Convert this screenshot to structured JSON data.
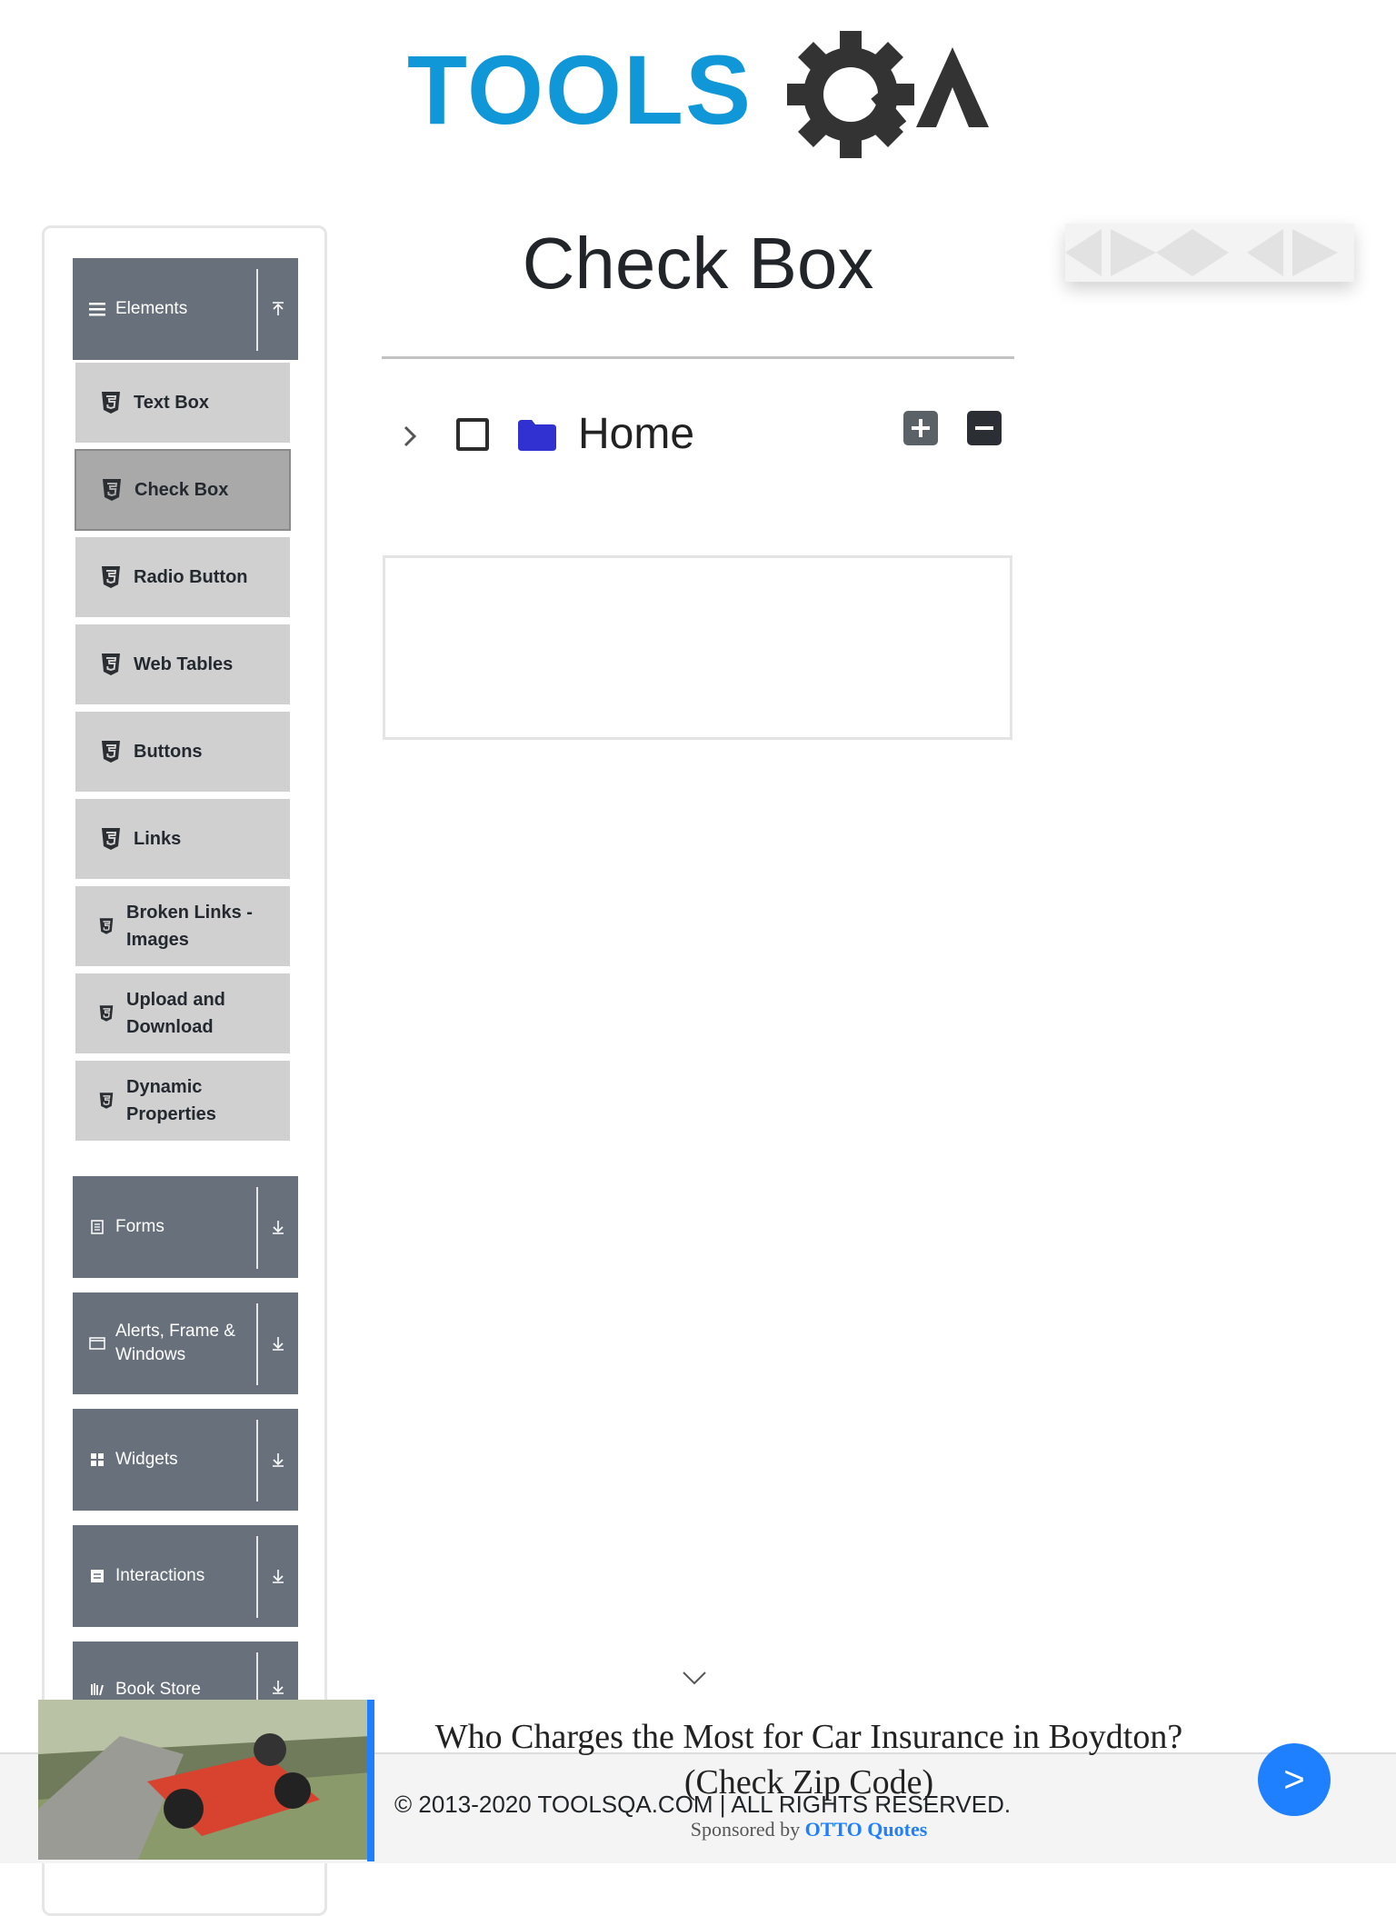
{
  "brand": {
    "logo_text": "TOOLSQA",
    "logo_tools": "TOOLS",
    "logo_q": "Q",
    "logo_a": "A",
    "logo_color": "#0f97d8",
    "logo_gear_color": "#333333"
  },
  "sidebar": {
    "groups": [
      {
        "label": "Elements",
        "icon": "menu-icon",
        "state": "expanded"
      },
      {
        "label": "Forms",
        "icon": "form-icon",
        "state": "collapsed"
      },
      {
        "label": "Alerts, Frame &",
        "label2": "Windows",
        "icon": "window-icon",
        "state": "collapsed"
      },
      {
        "label": "Widgets",
        "icon": "widgets-icon",
        "state": "collapsed"
      },
      {
        "label": "Interactions",
        "icon": "interactions-icon",
        "state": "collapsed"
      },
      {
        "label": "Book Store",
        "icon": "bookstore-icon",
        "state": "collapsed"
      }
    ],
    "items": [
      {
        "label": "Text Box"
      },
      {
        "label": "Check Box",
        "active": true
      },
      {
        "label": "Radio Button"
      },
      {
        "label": "Web Tables"
      },
      {
        "label": "Buttons"
      },
      {
        "label": "Links"
      },
      {
        "label": "Broken Links -",
        "label2": "Images"
      },
      {
        "label": "Upload and",
        "label2": "Download"
      },
      {
        "label": "Dynamic",
        "label2": "Properties"
      }
    ]
  },
  "main": {
    "title": "Check Box",
    "tree": {
      "root_label": "Home",
      "checked": false,
      "expanded": false
    }
  },
  "footer": {
    "text": "© 2013-2020 TOOLSQA.COM | ALL RIGHTS RESERVED."
  },
  "ad": {
    "headline_line1": "Who Charges the Most for Car Insurance in Boydton?",
    "headline_line2": "(Check Zip Code)",
    "sponsor_prefix": "Sponsored by",
    "sponsor_brand": "OTTO Quotes",
    "go_label": ">"
  },
  "colors": {
    "sidebar_header": "#68717b",
    "sidebar_item": "#d0d0d0",
    "sidebar_item_active": "#a9a9a9",
    "folder": "#3131d2",
    "ad_accent": "#1e7fff"
  }
}
